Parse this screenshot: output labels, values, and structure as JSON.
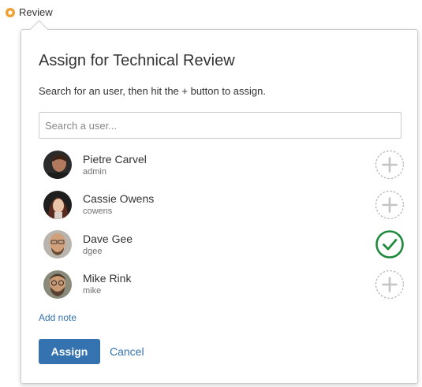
{
  "trigger": {
    "label": "Review",
    "icon": "status-circle-icon",
    "icon_color": "#f0a030"
  },
  "dialog": {
    "title": "Assign for Technical Review",
    "description": "Search for an user, then hit the + button to assign.",
    "search": {
      "placeholder": "Search a user...",
      "value": ""
    },
    "users": [
      {
        "name": "Pietre Carvel",
        "handle": "admin",
        "assigned": false
      },
      {
        "name": "Cassie Owens",
        "handle": "cowens",
        "assigned": false
      },
      {
        "name": "Dave Gee",
        "handle": "dgee",
        "assigned": true
      },
      {
        "name": "Mike Rink",
        "handle": "mike",
        "assigned": false
      }
    ],
    "add_note_label": "Add note",
    "assign_label": "Assign",
    "cancel_label": "Cancel"
  },
  "colors": {
    "primary": "#3572b0",
    "assigned": "#1f8a3c",
    "unassigned_outline": "#b8b8b8",
    "trigger_icon": "#f0a030"
  },
  "icons": {
    "add": "plus-circle-icon",
    "assigned": "check-circle-icon",
    "avatar": "user-avatar"
  }
}
